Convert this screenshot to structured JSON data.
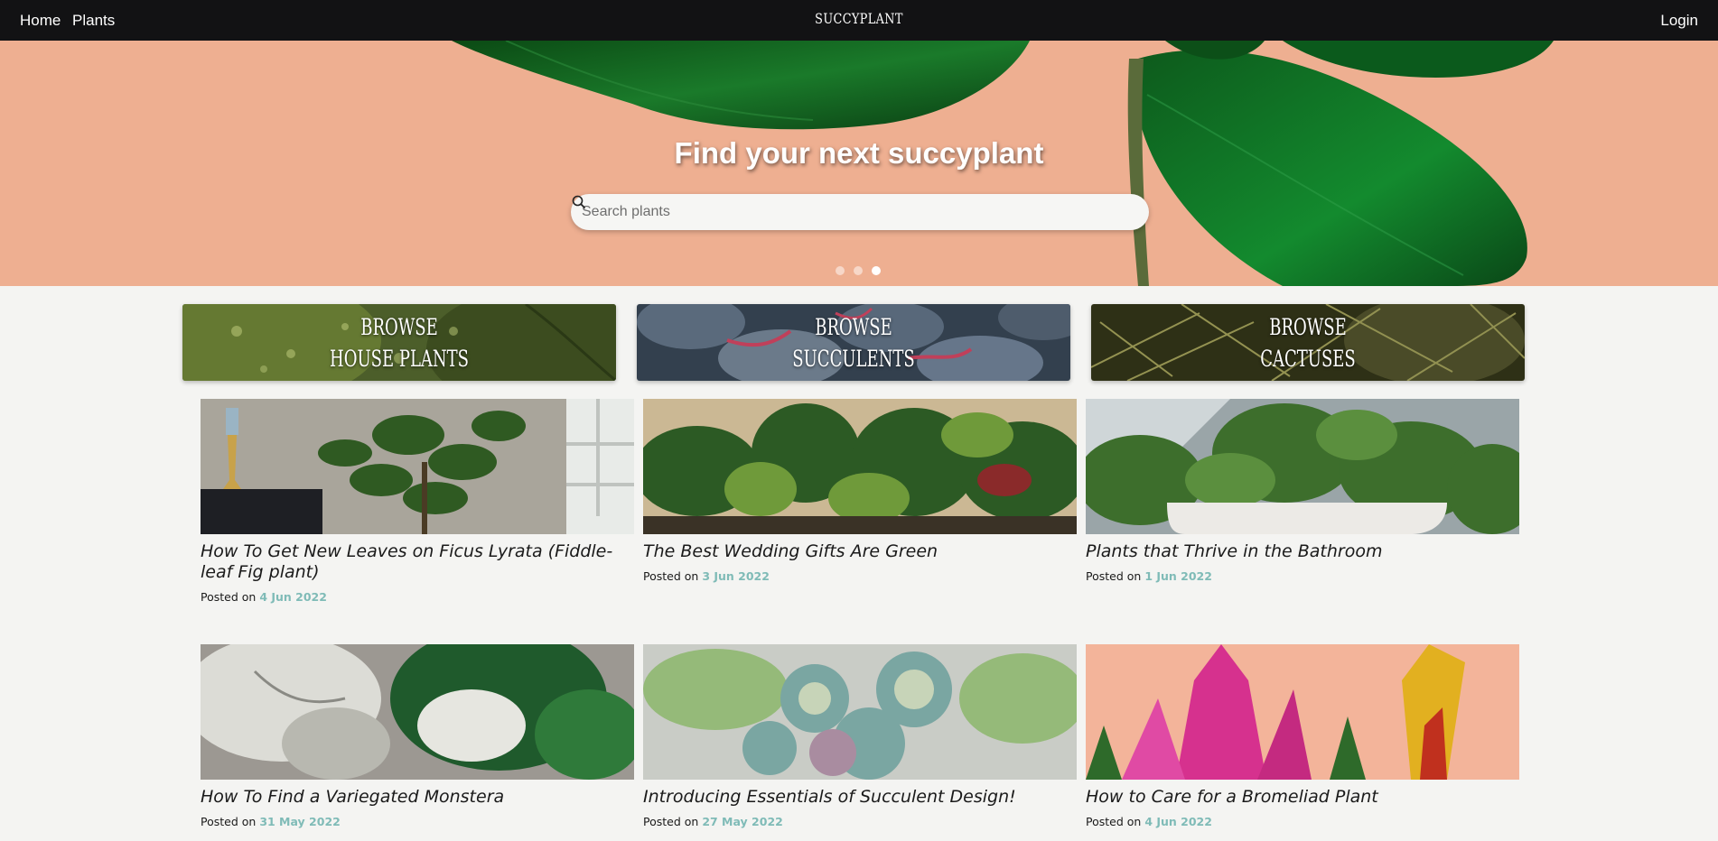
{
  "nav": {
    "home": "Home",
    "plants": "Plants",
    "brand": "SUCCYPLANT",
    "login": "Login"
  },
  "hero": {
    "title": "Find your next succyplant",
    "search_placeholder": "Search plants",
    "search_icon": "search-icon",
    "slides": 3,
    "active_slide": 3
  },
  "categories": [
    {
      "line1": "Browse",
      "line2": "House Plants"
    },
    {
      "line1": "Browse",
      "line2": "Succulents"
    },
    {
      "line1": "Browse",
      "line2": "Cactuses"
    }
  ],
  "posts": [
    {
      "title": "How To Get New Leaves on Ficus Lyrata (Fiddle-leaf Fig plant)",
      "posted_label": "Posted on",
      "date": "4 Jun 2022"
    },
    {
      "title": "The Best Wedding Gifts Are Green",
      "posted_label": "Posted on",
      "date": "3 Jun 2022"
    },
    {
      "title": "Plants that Thrive in the Bathroom",
      "posted_label": "Posted on",
      "date": "1 Jun 2022"
    },
    {
      "title": "How To Find a Variegated Monstera",
      "posted_label": "Posted on",
      "date": "31 May 2022"
    },
    {
      "title": "Introducing Essentials of Succulent Design!",
      "posted_label": "Posted on",
      "date": "27 May 2022"
    },
    {
      "title": "How to Care for a Bromeliad Plant",
      "posted_label": "Posted on",
      "date": "4 Jun 2022"
    }
  ],
  "colors": {
    "navbar": "#121214",
    "hero_bg": "#eeaf91",
    "date_accent": "#7fbbb7",
    "page_bg": "#f4f4f2"
  }
}
